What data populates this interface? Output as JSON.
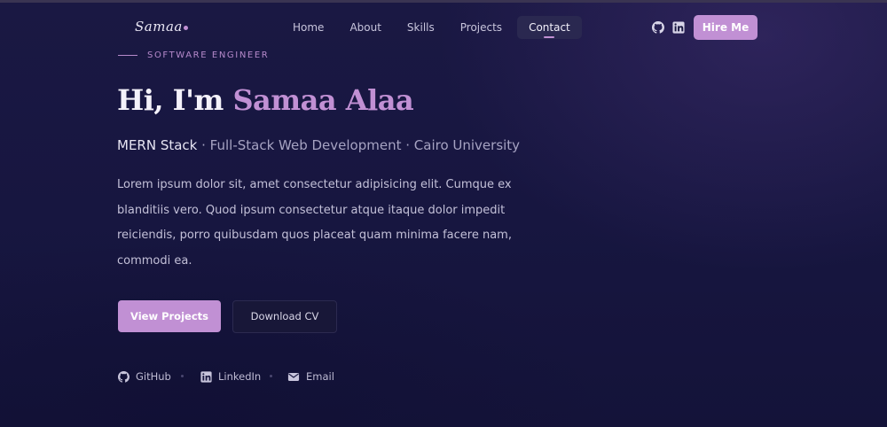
{
  "brand": {
    "name": "Samaa"
  },
  "nav": {
    "links": [
      {
        "label": "Home"
      },
      {
        "label": "About"
      },
      {
        "label": "Skills"
      },
      {
        "label": "Projects"
      },
      {
        "label": "Contact",
        "active": true
      }
    ],
    "icons": [
      "github-icon",
      "linkedin-icon"
    ],
    "hire_label": "Hire Me"
  },
  "hero": {
    "eyebrow": "SOFTWARE ENGINEER",
    "greeting": "Hi, I'm ",
    "name": "Samaa Alaa",
    "subtitle_strong": "MERN Stack",
    "subtitle_rest": " · Full-Stack Web Development · Cairo University",
    "description": "Lorem ipsum dolor sit, amet consectetur adipisicing elit. Cumque ex blanditiis vero. Quod ipsum consectetur atque itaque dolor impedit reiciendis, porro quibusdam quos placeat quam minima facere nam, commodi ea.",
    "primary_button": "View Projects",
    "secondary_button": "Download CV"
  },
  "social": [
    {
      "icon": "github-icon",
      "label": "GitHub"
    },
    {
      "icon": "linkedin-icon",
      "label": "LinkedIn"
    },
    {
      "icon": "email-icon",
      "label": "Email"
    }
  ],
  "colors": {
    "background": "#17163e",
    "accent": "#c190d4",
    "text": "#f4f2fa",
    "muted": "#a6a3c2"
  }
}
